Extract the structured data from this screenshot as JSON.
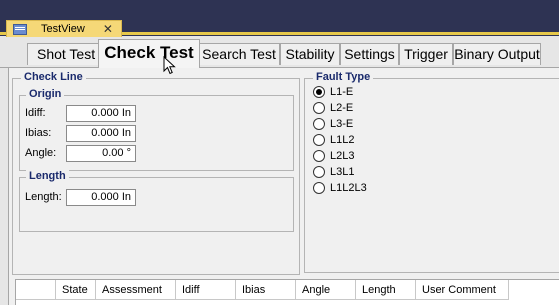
{
  "window": {
    "doc_title": "TestView",
    "close_glyph": "✕"
  },
  "tabs": [
    {
      "label": "Shot Test"
    },
    {
      "label": "Check Test",
      "active": true
    },
    {
      "label": "Search Test"
    },
    {
      "label": "Stability"
    },
    {
      "label": "Settings"
    },
    {
      "label": "Trigger"
    },
    {
      "label": "Binary Output"
    }
  ],
  "check_line": {
    "legend": "Check Line",
    "origin": {
      "legend": "Origin",
      "idiff_label": "Idiff:",
      "idiff_value": "0.000 In",
      "ibias_label": "Ibias:",
      "ibias_value": "0.000 In",
      "angle_label": "Angle:",
      "angle_value": "0.00 °"
    },
    "length": {
      "legend": "Length",
      "length_label": "Length:",
      "length_value": "0.000 In"
    }
  },
  "fault_type": {
    "legend": "Fault Type",
    "options": [
      "L1-E",
      "L2-E",
      "L3-E",
      "L1L2",
      "L2L3",
      "L3L1",
      "L1L2L3"
    ],
    "selected": "L1-E"
  },
  "grid": {
    "columns": [
      "",
      "State",
      "Assessment",
      "Idiff",
      "Ibias",
      "Angle",
      "Length",
      "User Comment"
    ]
  },
  "icons": {
    "doc": "document-icon",
    "cursor": "mouse-pointer-icon"
  },
  "colors": {
    "band": "#2e3353",
    "active_doc_tab": "#f5d877",
    "legend_text": "#1a2a6c"
  }
}
